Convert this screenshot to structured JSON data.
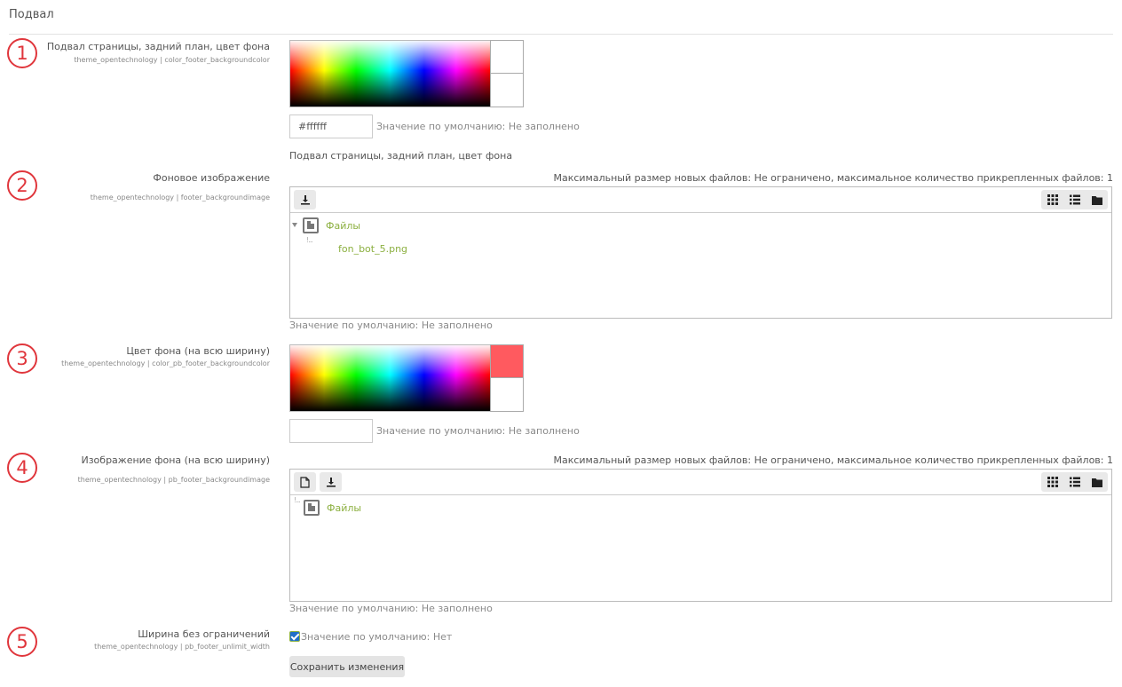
{
  "section": {
    "title": "Подвал"
  },
  "settings": [
    {
      "number": "1",
      "label": "Подвал страницы, задний план, цвет фона",
      "key": "theme_opentechnology | color_footer_backgroundcolor",
      "input_value": "#ffffff",
      "default_hint": "Значение по умолчанию: Не заполнено",
      "description": "Подвал страницы, задний план, цвет фона",
      "swatch_top": "#ffffff",
      "swatch_bottom": "#ffffff"
    },
    {
      "number": "2",
      "label": "Фоновое изображение",
      "key": "theme_opentechnology | footer_backgroundimage",
      "limits": "Максимальный размер новых файлов: Не ограничено, максимальное количество прикрепленных файлов: 1",
      "folder_name": "Файлы",
      "tree_dots": "!...",
      "file_name": "fon_bot_5.png",
      "default_hint": "Значение по умолчанию: Не заполнено"
    },
    {
      "number": "3",
      "label": "Цвет фона (на всю ширину)",
      "key": "theme_opentechnology | color_pb_footer_backgroundcolor",
      "input_value": "",
      "default_hint": "Значение по умолчанию: Не заполнено",
      "swatch_top": "#ff5a5f",
      "swatch_bottom": "#ffffff"
    },
    {
      "number": "4",
      "label": "Изображение фона (на всю ширину)",
      "key": "theme_opentechnology | pb_footer_backgroundimage",
      "limits": "Максимальный размер новых файлов: Не ограничено, максимальное количество прикрепленных файлов: 1",
      "folder_name": "Файлы",
      "tree_dots": "!...",
      "default_hint": "Значение по умолчанию: Не заполнено"
    },
    {
      "number": "5",
      "label": "Ширина без ограничений",
      "key": "theme_opentechnology | pb_footer_unlimit_width",
      "checked": true,
      "default_hint": "Значение по умолчанию: Нет"
    }
  ],
  "save_button": "Сохранить изменения",
  "colors": {
    "badge": "#e0363c",
    "link_green": "#8cb040",
    "checkbox_blue": "#1f6fc9"
  }
}
